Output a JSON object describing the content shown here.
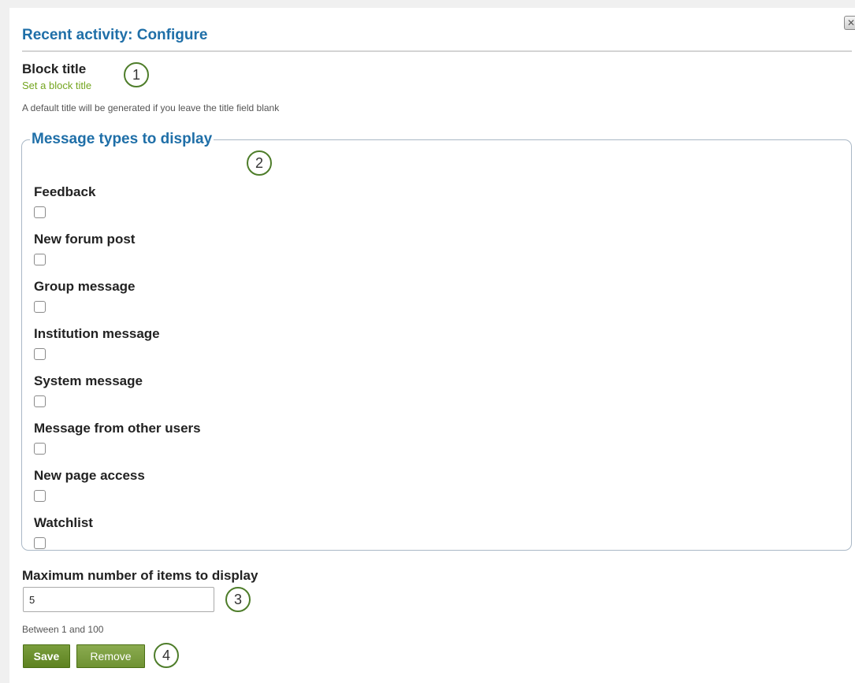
{
  "dialog": {
    "title": "Recent activity: Configure",
    "close_icon": "close-icon"
  },
  "block_title": {
    "label": "Block title",
    "link_text": "Set a block title",
    "help": "A default title will be generated if you leave the title field blank"
  },
  "message_types": {
    "legend": "Message types to display",
    "options": [
      {
        "label": "Feedback",
        "checked": false
      },
      {
        "label": "New forum post",
        "checked": false
      },
      {
        "label": "Group message",
        "checked": false
      },
      {
        "label": "Institution message",
        "checked": false
      },
      {
        "label": "System message",
        "checked": false
      },
      {
        "label": "Message from other users",
        "checked": false
      },
      {
        "label": "New page access",
        "checked": false
      },
      {
        "label": "Watchlist",
        "checked": false
      }
    ]
  },
  "max_items": {
    "label": "Maximum number of items to display",
    "value": "5",
    "help": "Between 1 and 100"
  },
  "buttons": {
    "save": "Save",
    "remove": "Remove"
  },
  "callouts": [
    "1",
    "2",
    "3",
    "4"
  ],
  "colors": {
    "heading_blue": "#1f6fa8",
    "link_green": "#74a51f",
    "button_green": "#5e8221",
    "callout_border": "#4e7d2a"
  }
}
